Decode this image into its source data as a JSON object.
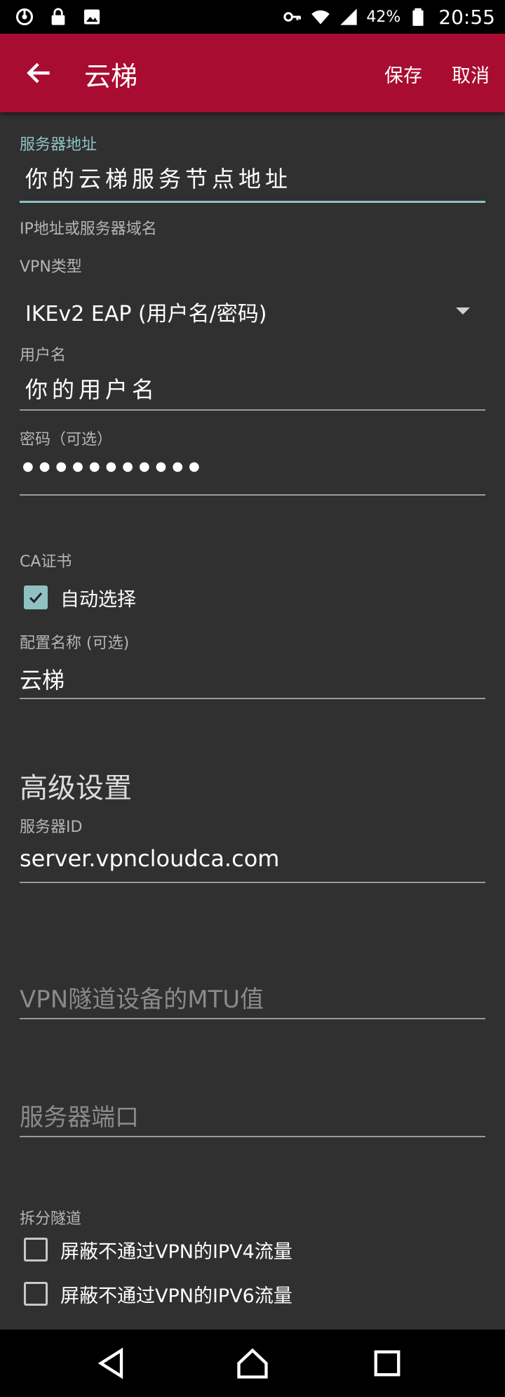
{
  "status_bar": {
    "left_icons": [
      "data-sync-icon",
      "lock-icon",
      "image-icon"
    ],
    "right_icons": [
      "vpn-key-icon",
      "wifi-icon",
      "signal-icon",
      "battery-icon"
    ],
    "battery": "42%",
    "time": "20:55"
  },
  "app_bar": {
    "title": "云梯",
    "save": "保存",
    "cancel": "取消",
    "color": "#a80c30"
  },
  "server": {
    "label": "服务器地址",
    "value": "你的云梯服务节点地址",
    "helper": "IP地址或服务器域名"
  },
  "vpn_type": {
    "label": "VPN类型",
    "value": "IKEv2 EAP (用户名/密码)"
  },
  "username": {
    "label": "用户名",
    "value": "你的用户名"
  },
  "password": {
    "label": "密码（可选）",
    "value": "●●●●●●●●●●●"
  },
  "ca": {
    "label": "CA证书",
    "auto_select": "自动选择",
    "checked": true
  },
  "profile": {
    "label": "配置名称 (可选)",
    "value": "云梯"
  },
  "advanced": {
    "title": "高级设置",
    "server_id_label": "服务器ID",
    "server_id_value": "server.vpncloudca.com",
    "mtu_placeholder": "VPN隧道设备的MTU值",
    "port_placeholder": "服务器端口"
  },
  "split": {
    "label": "拆分隧道",
    "ipv4": "屏蔽不通过VPN的IPV4流量",
    "ipv6": "屏蔽不通过VPN的IPV6流量",
    "ipv4_checked": false,
    "ipv6_checked": false
  },
  "accent_color": "#8fc1c4"
}
